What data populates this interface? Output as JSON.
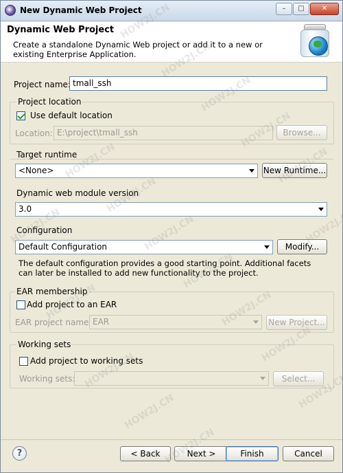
{
  "window": {
    "title": "New Dynamic Web Project",
    "min_glyph": "–",
    "max_glyph": "□",
    "close_glyph": "✕"
  },
  "header": {
    "title": "Dynamic Web Project",
    "description": "Create a standalone Dynamic Web project or add it to a new or existing Enterprise Application.",
    "icon": "web-project-jar-globe-icon"
  },
  "project_name": {
    "label": "Project name:",
    "value": "tmall_ssh"
  },
  "project_location": {
    "group_label": "Project location",
    "use_default_label": "Use default location",
    "use_default_checked": true,
    "location_label": "Location:",
    "location_value": "E:\\project\\tmall_ssh",
    "browse_label": "Browse..."
  },
  "target_runtime": {
    "group_label": "Target runtime",
    "value": "<None>",
    "new_runtime_label": "New Runtime..."
  },
  "module_version": {
    "group_label": "Dynamic web module version",
    "value": "3.0"
  },
  "configuration": {
    "group_label": "Configuration",
    "value": "Default Configuration",
    "modify_label": "Modify...",
    "description": "The default configuration provides a good starting point. Additional facets can later be installed to add new functionality to the project."
  },
  "ear_membership": {
    "group_label": "EAR membership",
    "add_label": "Add project to an EAR",
    "add_checked": false,
    "ear_project_label": "EAR project name:",
    "ear_project_value": "EAR",
    "new_project_label": "New Project..."
  },
  "working_sets": {
    "group_label": "Working sets",
    "add_label": "Add project to working sets",
    "add_checked": false,
    "working_sets_label": "Working sets:",
    "working_sets_value": "",
    "select_label": "Select..."
  },
  "footer": {
    "help_glyph": "?",
    "back_label": "< Back",
    "next_label": "Next >",
    "finish_label": "Finish",
    "cancel_label": "Cancel"
  },
  "watermark_text": "HOW2J.CN"
}
